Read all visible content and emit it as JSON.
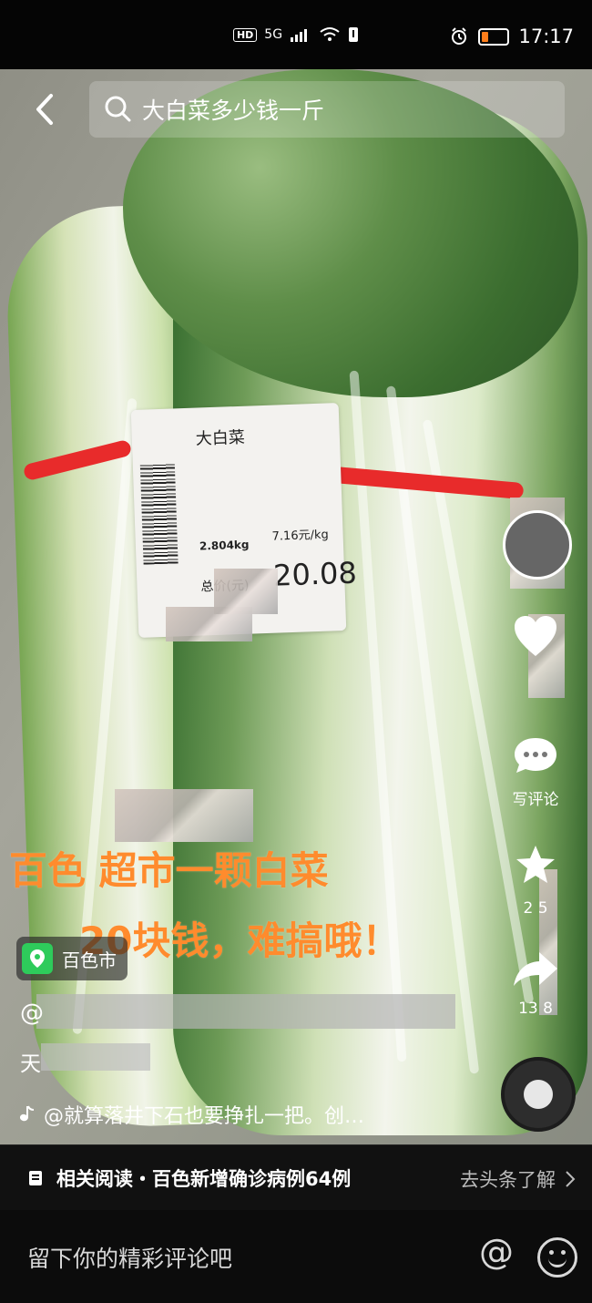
{
  "status_bar": {
    "hd": "HD",
    "signal": "5G",
    "time": "17:17",
    "battery_color": "#ff7d1a",
    "icons": [
      "wifi-icon",
      "battery-icon",
      "alarm-icon",
      "signal-icon"
    ]
  },
  "header": {
    "search_query": "大白菜多少钱一斤",
    "back_icon": "chevron-left-icon",
    "search_icon": "search-icon"
  },
  "price_label": {
    "name": "大白菜",
    "weight": "2.804kg",
    "unit_price": "7.16元/kg",
    "total_title": "总价(元)",
    "total": "20.08"
  },
  "overlay": {
    "line1": "百色         超市一颗白菜",
    "line2": "20块钱，难搞哦！"
  },
  "side_actions": {
    "comment_label": "写评论",
    "favorite_count": "2 5",
    "share_count": "13 8"
  },
  "footer": {
    "location": "百色市",
    "author_prefix": "@",
    "desc_prefix": "天",
    "music": "@就算落井下石也要挣扎一把。创…"
  },
  "related": {
    "text": "相关阅读・百色新增确诊病例64例",
    "link": "去头条了解"
  },
  "comment_bar": {
    "placeholder": "留下你的精彩评论吧",
    "at_symbol": "@"
  },
  "colors": {
    "overlay_text": "#ff8b2d",
    "band": "#e82b2b",
    "location_icon": "#2ecb5b"
  }
}
